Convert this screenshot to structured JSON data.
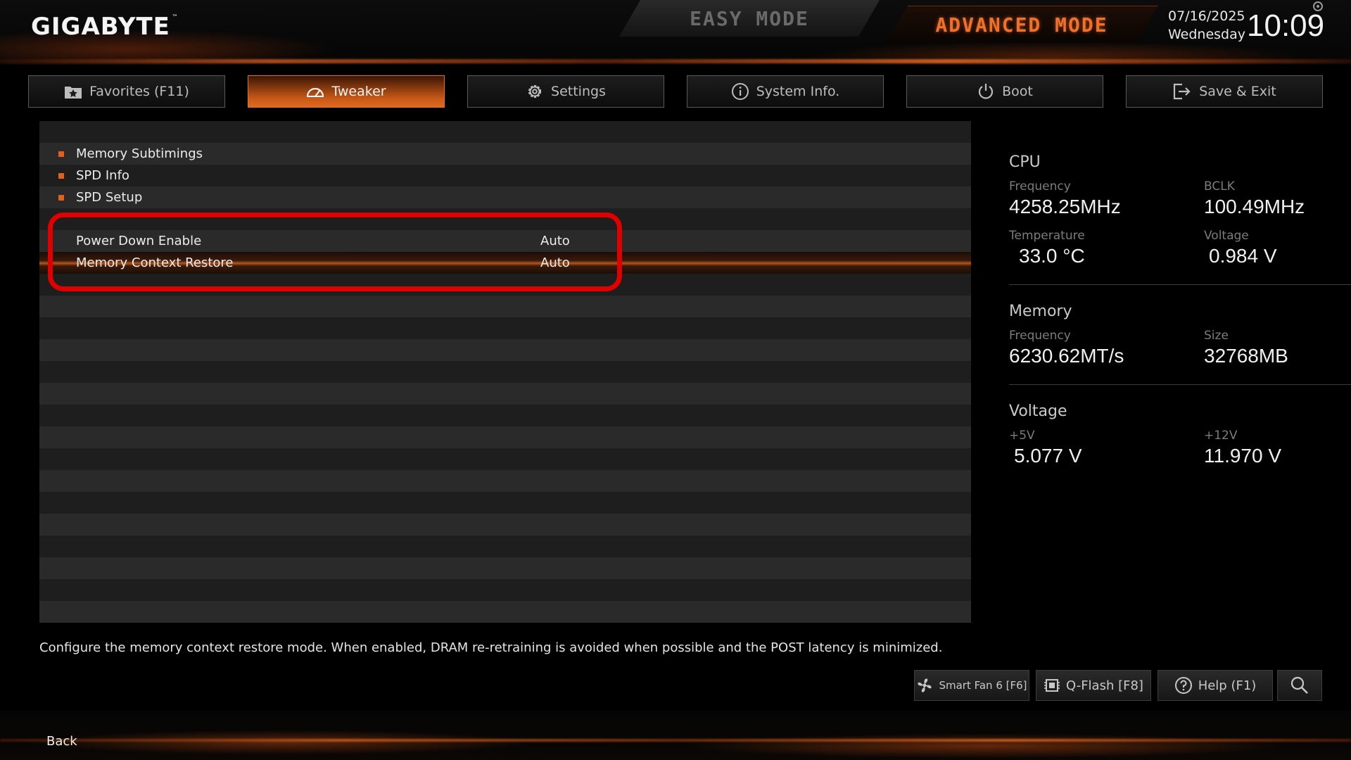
{
  "header": {
    "brand": "GIGABYTE",
    "brand_tm": "™",
    "easy_mode": "EASY MODE",
    "advanced_mode": "ADVANCED MODE",
    "date": "07/16/2025",
    "weekday": "Wednesday",
    "time": "10:09"
  },
  "tabs": [
    {
      "label": "Favorites (F11)",
      "icon": "star-folder-icon",
      "active": false
    },
    {
      "label": "Tweaker",
      "icon": "speedometer-icon",
      "active": true
    },
    {
      "label": "Settings",
      "icon": "gear-icon",
      "active": false
    },
    {
      "label": "System Info.",
      "icon": "info-icon",
      "active": false
    },
    {
      "label": "Boot",
      "icon": "power-icon",
      "active": false
    },
    {
      "label": "Save & Exit",
      "icon": "exit-icon",
      "active": false
    }
  ],
  "menu": {
    "submenus": [
      "Memory Subtimings",
      "SPD Info",
      "SPD Setup"
    ],
    "settings": [
      {
        "label": "Power Down Enable",
        "value": "Auto"
      },
      {
        "label": "Memory Context Restore",
        "value": "Auto"
      }
    ],
    "selected": "Memory Context Restore"
  },
  "hw_monitor": {
    "cpu": {
      "title": "CPU",
      "frequency_label": "Frequency",
      "frequency": "4258.25MHz",
      "bclk_label": "BCLK",
      "bclk": "100.49MHz",
      "temperature_label": "Temperature",
      "temperature": "33.0 °C",
      "voltage_label": "Voltage",
      "voltage": "0.984 V"
    },
    "memory": {
      "title": "Memory",
      "frequency_label": "Frequency",
      "frequency": "6230.62MT/s",
      "size_label": "Size",
      "size": "32768MB"
    },
    "voltage": {
      "title": "Voltage",
      "v5_label": "+5V",
      "v5": "5.077 V",
      "v12_label": "+12V",
      "v12": "11.970 V"
    }
  },
  "description": "Configure the memory context restore mode. When enabled, DRAM re-retraining is avoided when possible and the POST latency is minimized.",
  "bottom_buttons": {
    "smart_fan": "Smart Fan 6 [F6]",
    "qflash": "Q-Flash [F8]",
    "help": "Help (F1)"
  },
  "footer": {
    "back": "Back"
  },
  "colors": {
    "accent": "#e0601c",
    "highlight_box": "#e00000",
    "active_tab": "#c45716"
  }
}
